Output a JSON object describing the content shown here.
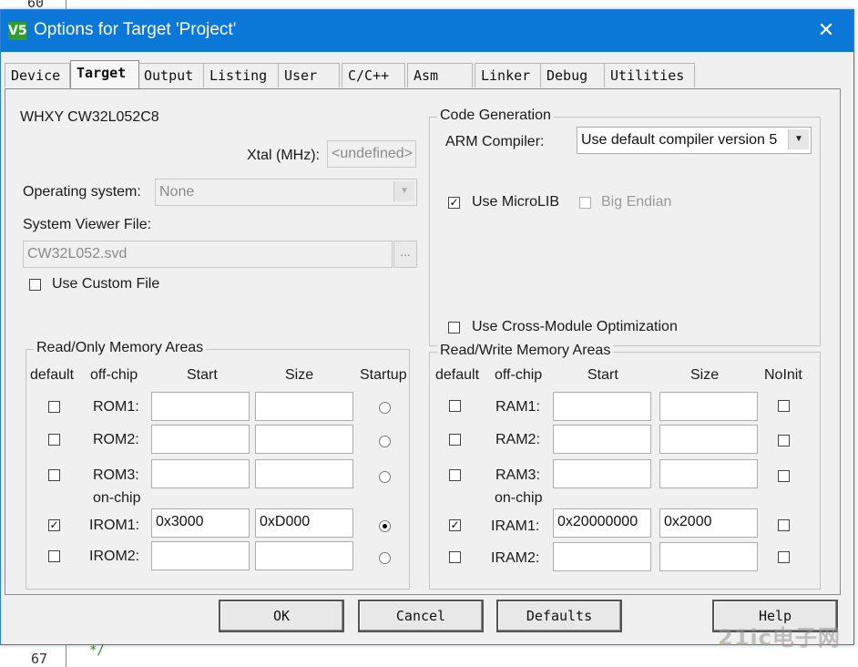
{
  "background": {
    "top_line_number": "60",
    "bottom_line_number": "67",
    "bottom_code": "*/"
  },
  "dialog": {
    "title": "Options for Target 'Project'",
    "app_icon": "V5",
    "close_label": "✕"
  },
  "tabs": [
    {
      "label": "Device"
    },
    {
      "label": "Target"
    },
    {
      "label": "Output"
    },
    {
      "label": "Listing"
    },
    {
      "label": "User"
    },
    {
      "label": "C/C++"
    },
    {
      "label": "Asm"
    },
    {
      "label": "Linker"
    },
    {
      "label": "Debug"
    },
    {
      "label": "Utilities"
    }
  ],
  "active_tab": "Target",
  "target": {
    "device_name": "WHXY CW32L052C8",
    "xtal_label": "Xtal (MHz):",
    "xtal_value": "<undefined>",
    "os_label": "Operating system:",
    "os_value": "None",
    "svd_label": "System Viewer File:",
    "svd_value": "CW32L052.svd",
    "browse_label": "...",
    "custom_file_label": "Use Custom File",
    "custom_file_checked": false
  },
  "code_generation": {
    "title": "Code Generation",
    "compiler_label": "ARM Compiler:",
    "compiler_value": "Use default compiler version 5",
    "microlib_label": "Use MicroLIB",
    "microlib_checked": true,
    "big_endian_label": "Big Endian",
    "big_endian_checked": false,
    "cross_module_label": "Use Cross-Module Optimization",
    "cross_module_checked": false
  },
  "ro_memory": {
    "title": "Read/Only Memory Areas",
    "headers": {
      "default": "default",
      "offchip": "off-chip",
      "start": "Start",
      "size": "Size",
      "last": "Startup"
    },
    "onchip_label": "on-chip",
    "rows": [
      {
        "name": "ROM1:",
        "start": "",
        "size": "",
        "default": false,
        "selected": false
      },
      {
        "name": "ROM2:",
        "start": "",
        "size": "",
        "default": false,
        "selected": false
      },
      {
        "name": "ROM3:",
        "start": "",
        "size": "",
        "default": false,
        "selected": false
      },
      {
        "name": "IROM1:",
        "start": "0x3000",
        "size": "0xD000",
        "default": true,
        "selected": true
      },
      {
        "name": "IROM2:",
        "start": "",
        "size": "",
        "default": false,
        "selected": false
      }
    ]
  },
  "rw_memory": {
    "title": "Read/Write Memory Areas",
    "headers": {
      "default": "default",
      "offchip": "off-chip",
      "start": "Start",
      "size": "Size",
      "last": "NoInit"
    },
    "onchip_label": "on-chip",
    "rows": [
      {
        "name": "RAM1:",
        "start": "",
        "size": "",
        "default": false,
        "noinit": false
      },
      {
        "name": "RAM2:",
        "start": "",
        "size": "",
        "default": false,
        "noinit": false
      },
      {
        "name": "RAM3:",
        "start": "",
        "size": "",
        "default": false,
        "noinit": false
      },
      {
        "name": "IRAM1:",
        "start": "0x20000000",
        "size": "0x2000",
        "default": true,
        "noinit": false
      },
      {
        "name": "IRAM2:",
        "start": "",
        "size": "",
        "default": false,
        "noinit": false
      }
    ]
  },
  "buttons": {
    "ok": "OK",
    "cancel": "Cancel",
    "defaults": "Defaults",
    "help": "Help"
  },
  "watermark": "21ic电子网"
}
